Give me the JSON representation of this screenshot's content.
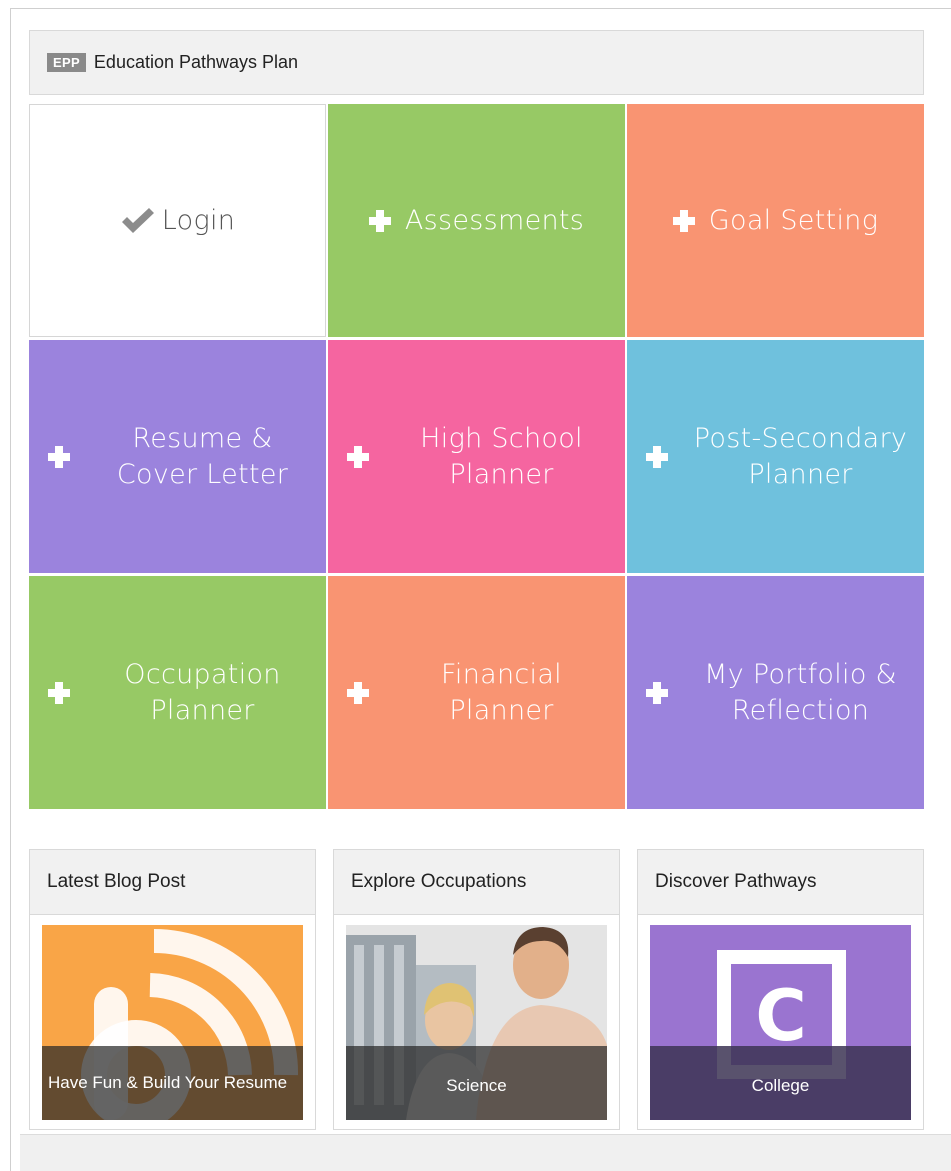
{
  "header": {
    "badge": "EPP",
    "title": "Education Pathways Plan"
  },
  "tiles": [
    {
      "label": "Login",
      "icon": "check-icon",
      "color": "#ffffff"
    },
    {
      "label": "Assessments",
      "icon": "plus-icon",
      "color": "#97c965"
    },
    {
      "label": "Goal Setting",
      "icon": "plus-icon",
      "color": "#f99472"
    },
    {
      "label": "Resume & Cover Letter",
      "icon": "plus-icon",
      "color": "#9b83dd"
    },
    {
      "label": "High School Planner",
      "icon": "plus-icon",
      "color": "#f565a0"
    },
    {
      "label": "Post-Secondary Planner",
      "icon": "plus-icon",
      "color": "#6fc1dd"
    },
    {
      "label": "Occupation Planner",
      "icon": "plus-icon",
      "color": "#97c965"
    },
    {
      "label": "Financial Planner",
      "icon": "plus-icon",
      "color": "#f99472"
    },
    {
      "label": "My Portfolio & Reflection",
      "icon": "plus-icon",
      "color": "#9b83dd"
    }
  ],
  "cards": [
    {
      "title": "Latest Blog Post",
      "caption": "Have Fun & Build Your Resume",
      "icon": "rss-icon"
    },
    {
      "title": "Explore Occupations",
      "caption": "Science",
      "icon": "people-photo"
    },
    {
      "title": "Discover Pathways",
      "caption": "College",
      "icon": "college-c-icon"
    }
  ]
}
